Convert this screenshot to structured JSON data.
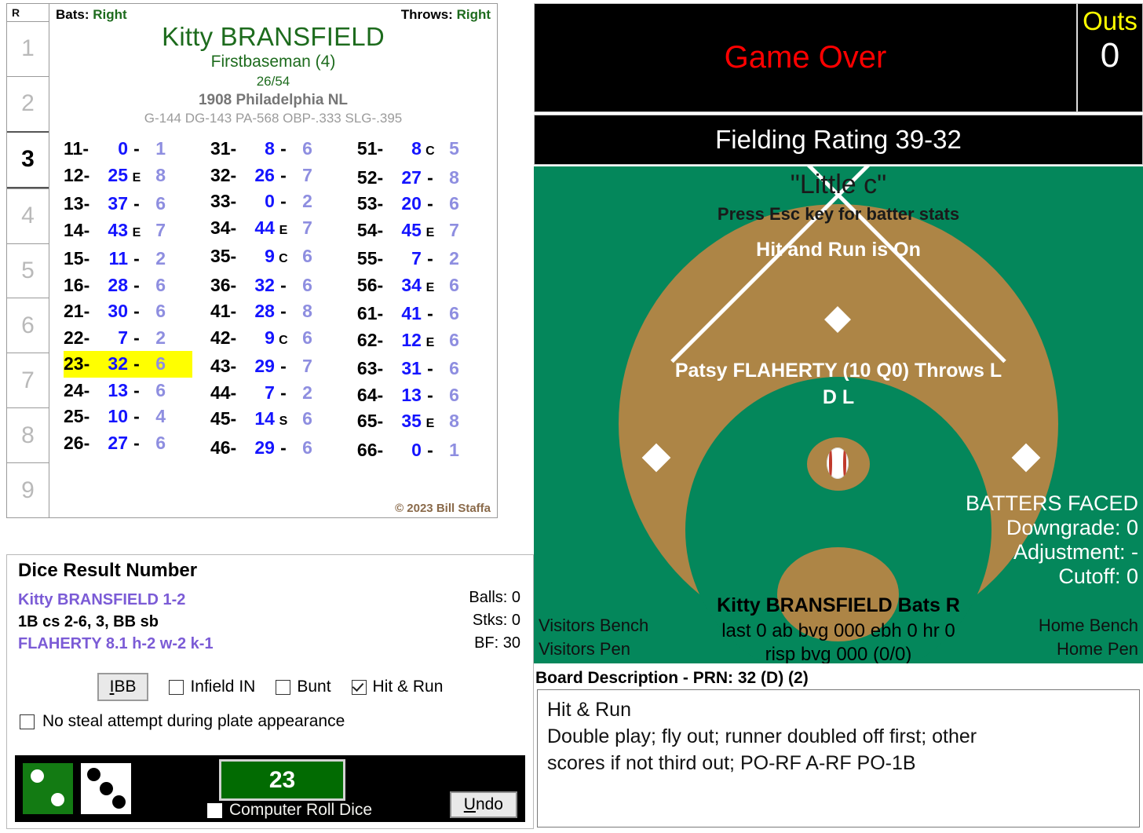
{
  "innings": {
    "header": "R",
    "cells": [
      "1",
      "2",
      "3",
      "4",
      "5",
      "6",
      "7",
      "8",
      "9"
    ],
    "active_index": 2
  },
  "batter_card": {
    "bats_label": "Bats:",
    "bats_value": "Right",
    "throws_label": "Throws:",
    "throws_value": "Right",
    "name": "Kitty BRANSFIELD",
    "position": "Firstbaseman (4)",
    "ratio": "26/54",
    "team": "1908 Philadelphia NL",
    "stats": "G-144 DG-143 PA-568 OBP-.333 SLG-.395",
    "copyright": "© 2023 Bill Staffa",
    "rolls_col1": [
      {
        "key": "11-",
        "value": "0",
        "mark": "-",
        "right": "1"
      },
      {
        "key": "12-",
        "value": "25",
        "mark": "E",
        "right": "8"
      },
      {
        "key": "13-",
        "value": "37",
        "mark": "-",
        "right": "6"
      },
      {
        "key": "14-",
        "value": "43",
        "mark": "E",
        "right": "7"
      },
      {
        "key": "15-",
        "value": "11",
        "mark": "-",
        "right": "2"
      },
      {
        "key": "16-",
        "value": "28",
        "mark": "-",
        "right": "6"
      },
      {
        "key": "21-",
        "value": "30",
        "mark": "-",
        "right": "6"
      },
      {
        "key": "22-",
        "value": "7",
        "mark": "-",
        "right": "2"
      },
      {
        "key": "23-",
        "value": "32",
        "mark": "-",
        "right": "6",
        "highlight": true
      },
      {
        "key": "24-",
        "value": "13",
        "mark": "-",
        "right": "6"
      },
      {
        "key": "25-",
        "value": "10",
        "mark": "-",
        "right": "4"
      },
      {
        "key": "26-",
        "value": "27",
        "mark": "-",
        "right": "6"
      }
    ],
    "rolls_col2": [
      {
        "key": "31-",
        "value": "8",
        "mark": "-",
        "right": "6"
      },
      {
        "key": "32-",
        "value": "26",
        "mark": "-",
        "right": "7"
      },
      {
        "key": "33-",
        "value": "0",
        "mark": "-",
        "right": "2"
      },
      {
        "key": "34-",
        "value": "44",
        "mark": "E",
        "right": "7"
      },
      {
        "key": "35-",
        "value": "9",
        "mark": "C",
        "right": "6"
      },
      {
        "key": "36-",
        "value": "32",
        "mark": "-",
        "right": "6"
      },
      {
        "key": "41-",
        "value": "28",
        "mark": "-",
        "right": "8"
      },
      {
        "key": "42-",
        "value": "9",
        "mark": "C",
        "right": "6"
      },
      {
        "key": "43-",
        "value": "29",
        "mark": "-",
        "right": "7"
      },
      {
        "key": "44-",
        "value": "7",
        "mark": "-",
        "right": "2"
      },
      {
        "key": "45-",
        "value": "14",
        "mark": "S",
        "right": "6"
      },
      {
        "key": "46-",
        "value": "29",
        "mark": "-",
        "right": "6"
      }
    ],
    "rolls_col3": [
      {
        "key": "51-",
        "value": "8",
        "mark": "C",
        "right": "5"
      },
      {
        "key": "52-",
        "value": "27",
        "mark": "-",
        "right": "8"
      },
      {
        "key": "53-",
        "value": "20",
        "mark": "-",
        "right": "6"
      },
      {
        "key": "54-",
        "value": "45",
        "mark": "E",
        "right": "7"
      },
      {
        "key": "55-",
        "value": "7",
        "mark": "-",
        "right": "2"
      },
      {
        "key": "56-",
        "value": "34",
        "mark": "E",
        "right": "6"
      },
      {
        "key": "61-",
        "value": "41",
        "mark": "-",
        "right": "6"
      },
      {
        "key": "62-",
        "value": "12",
        "mark": "E",
        "right": "6"
      },
      {
        "key": "63-",
        "value": "31",
        "mark": "-",
        "right": "6"
      },
      {
        "key": "64-",
        "value": "13",
        "mark": "-",
        "right": "6"
      },
      {
        "key": "65-",
        "value": "35",
        "mark": "E",
        "right": "8"
      },
      {
        "key": "66-",
        "value": "0",
        "mark": "-",
        "right": "1"
      }
    ]
  },
  "dice_panel": {
    "title": "Dice Result Number",
    "line1": "Kitty BRANSFIELD  1-2",
    "line2": "1B cs 2-6, 3, BB sb",
    "line3": "FLAHERTY  8.1  h-2  w-2  k-1",
    "balls": "Balls: 0",
    "strikes": "Stks: 0",
    "bf": "BF: 30",
    "ibb_label": "IBB",
    "infield_in_label": "Infield IN",
    "bunt_label": "Bunt",
    "hit_run_label": "Hit & Run",
    "hit_run_checked": true,
    "infield_in_checked": false,
    "bunt_checked": false,
    "no_steal_label": "No steal attempt during plate appearance",
    "no_steal_checked": false,
    "roll_value": "23",
    "computer_roll_label": "Computer Roll Dice",
    "computer_roll_checked": false,
    "undo_label": "Undo",
    "green_die_pips": 2,
    "white_die_pips": 3
  },
  "scoreboard": {
    "status": "Game Over",
    "outs_label": "Outs",
    "outs_value": "0",
    "fielding_rating": "Fielding Rating 39-32"
  },
  "field": {
    "title": "\"Little c\"",
    "subtitle": "Press Esc key for batter stats",
    "hit_and_run": "Hit and Run is On",
    "pitcher": "Patsy FLAHERTY (10 Q0) Throws L",
    "pitcher_sub": "D L",
    "batter": "Kitty BRANSFIELD Bats R",
    "batter_stats1": "last 0 ab bvg 000 ebh 0 hr 0",
    "batter_stats2": "risp bvg 000 (0/0)",
    "batters_faced_title": "BATTERS FACED",
    "downgrade": "Downgrade: 0",
    "adjustment": "Adjustment: -",
    "cutoff": "Cutoff: 0",
    "visitors_bench": "Visitors Bench",
    "visitors_pen": "Visitors Pen",
    "home_bench": "Home Bench",
    "home_pen": "Home Pen"
  },
  "board_description": {
    "title": "Board Description - PRN: 32 (D) (2)",
    "line1": "Hit & Run",
    "line2": "Double play; fly out; runner doubled off first; other",
    "line3": "scores if not third out; PO-RF A-RF PO-1B"
  },
  "colors": {
    "field_green": "#04875b",
    "dirt": "#ad8546",
    "highlight_yellow": "#ffff00",
    "roll_green": "#026b02",
    "accent_blue": "#1414ff",
    "name_green": "#1d6b1d",
    "purple": "#7b5bd6",
    "red": "#ff0000",
    "outs_yellow": "#ffff00"
  }
}
